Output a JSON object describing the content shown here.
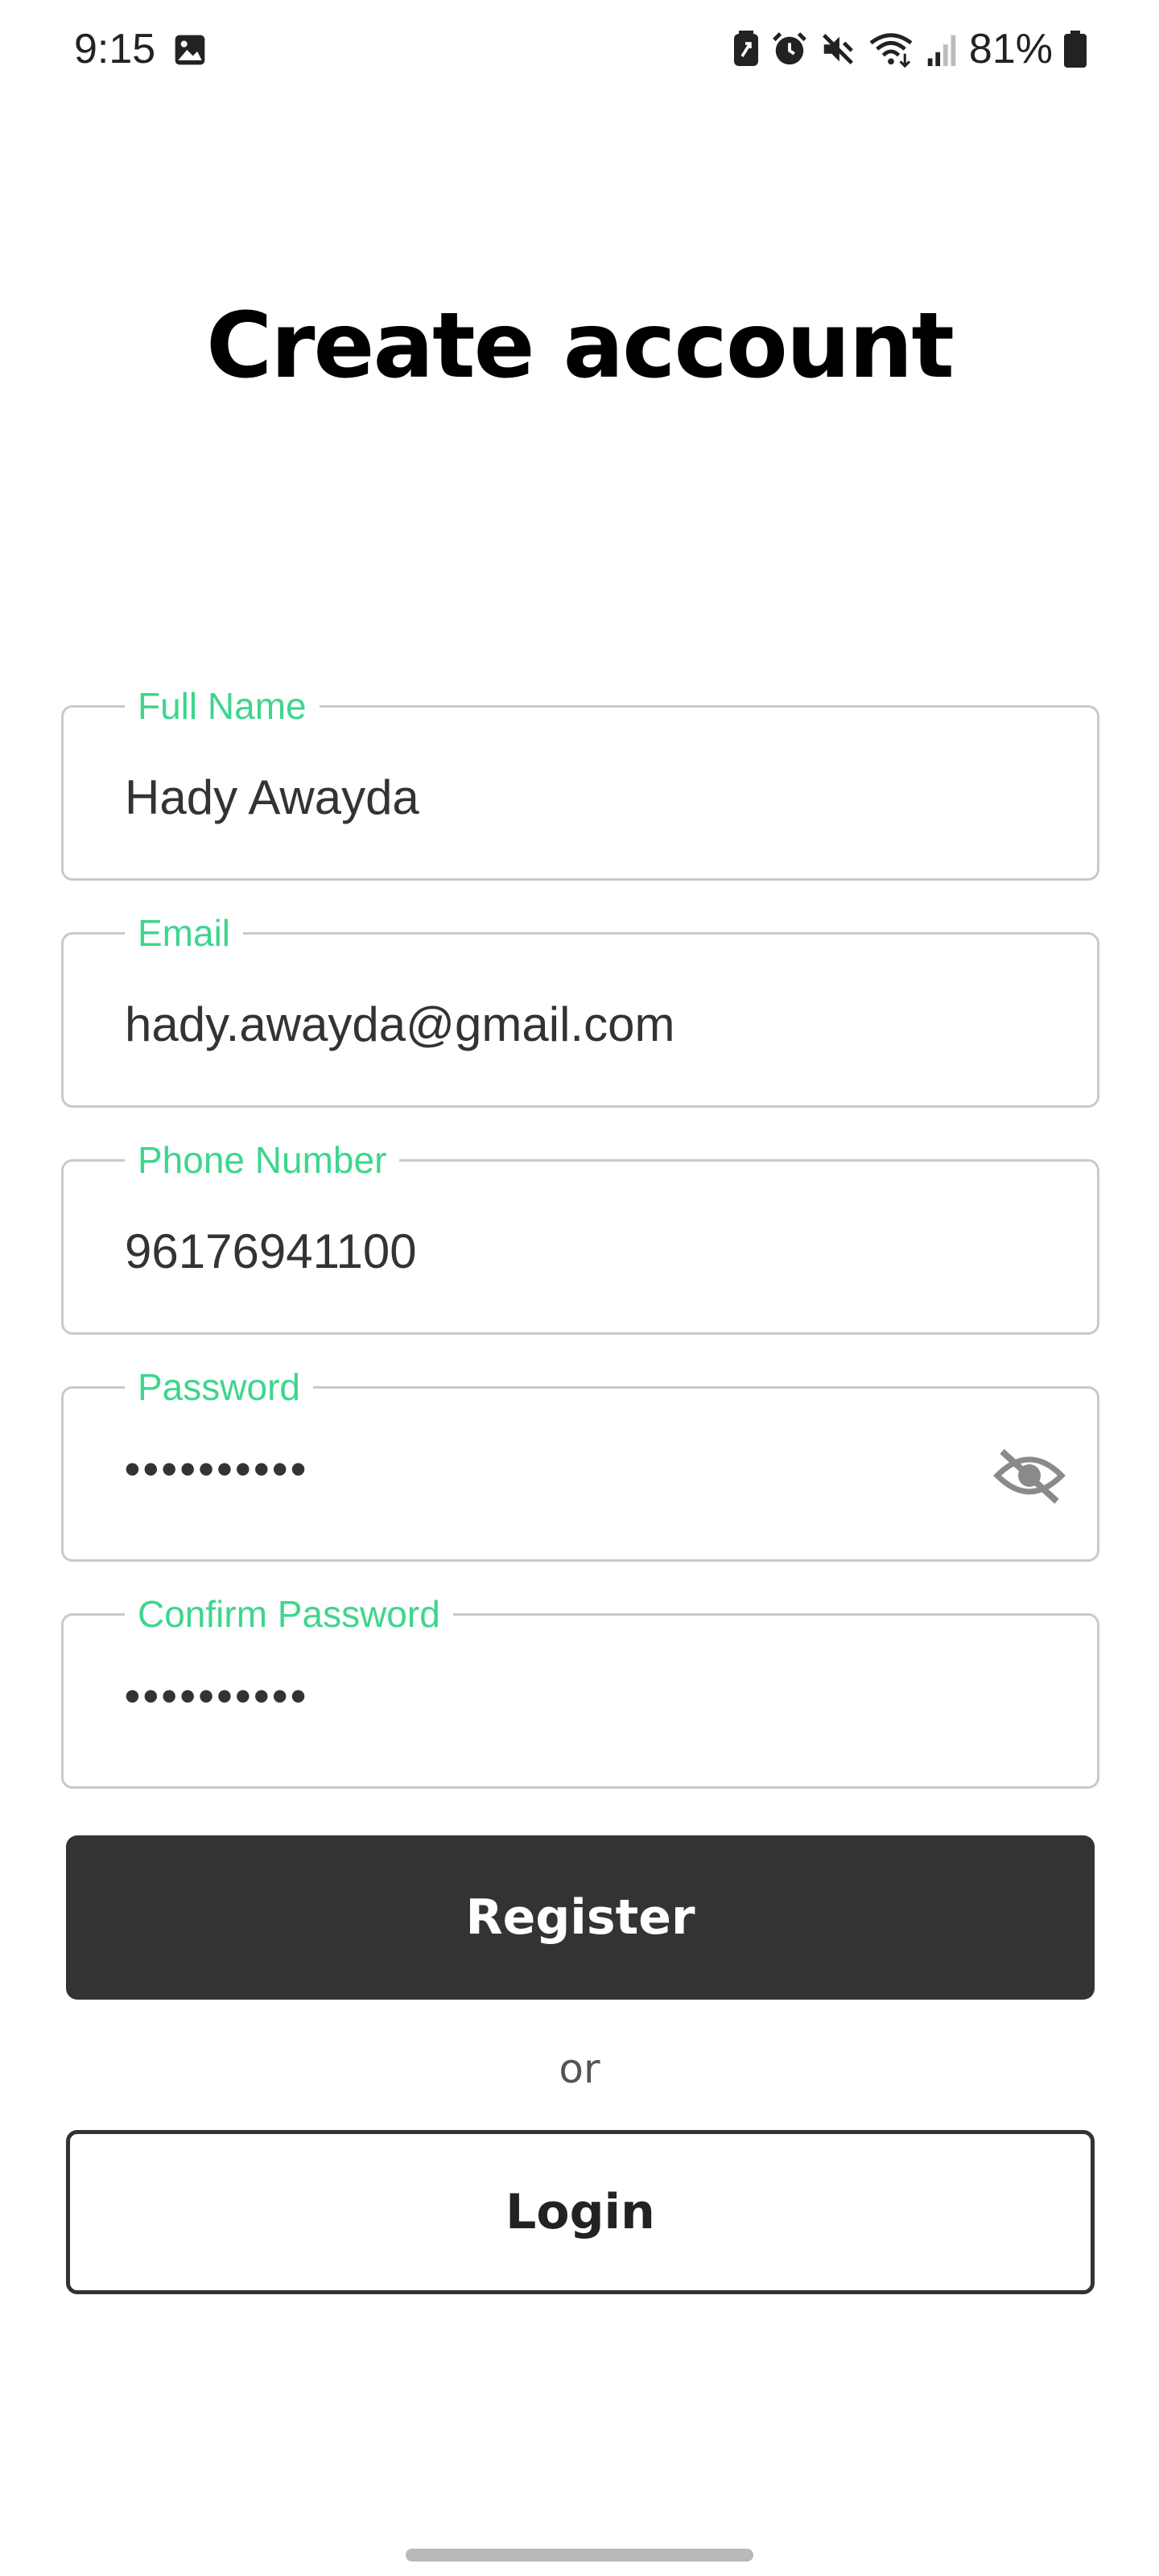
{
  "status_bar": {
    "time": "9:15",
    "battery_percent": "81%",
    "icons": [
      "gallery-icon",
      "battery-saver-icon",
      "alarm-icon",
      "mute-icon",
      "wifi-icon",
      "signal-icon",
      "battery-icon"
    ]
  },
  "title": "Create account",
  "form": {
    "full_name": {
      "label": "Full Name",
      "value": "Hady Awayda"
    },
    "email": {
      "label": "Email",
      "value": "hady.awayda@gmail.com"
    },
    "phone": {
      "label": "Phone Number",
      "value": "96176941100"
    },
    "password": {
      "label": "Password",
      "value": "••••••••••"
    },
    "confirm_password": {
      "label": "Confirm Password",
      "value": "••••••••••"
    }
  },
  "actions": {
    "register_label": "Register",
    "or_label": "or",
    "login_label": "Login"
  },
  "colors": {
    "accent": "#3dd68c",
    "primary_button": "#333333",
    "field_border": "#c9c9c9"
  }
}
